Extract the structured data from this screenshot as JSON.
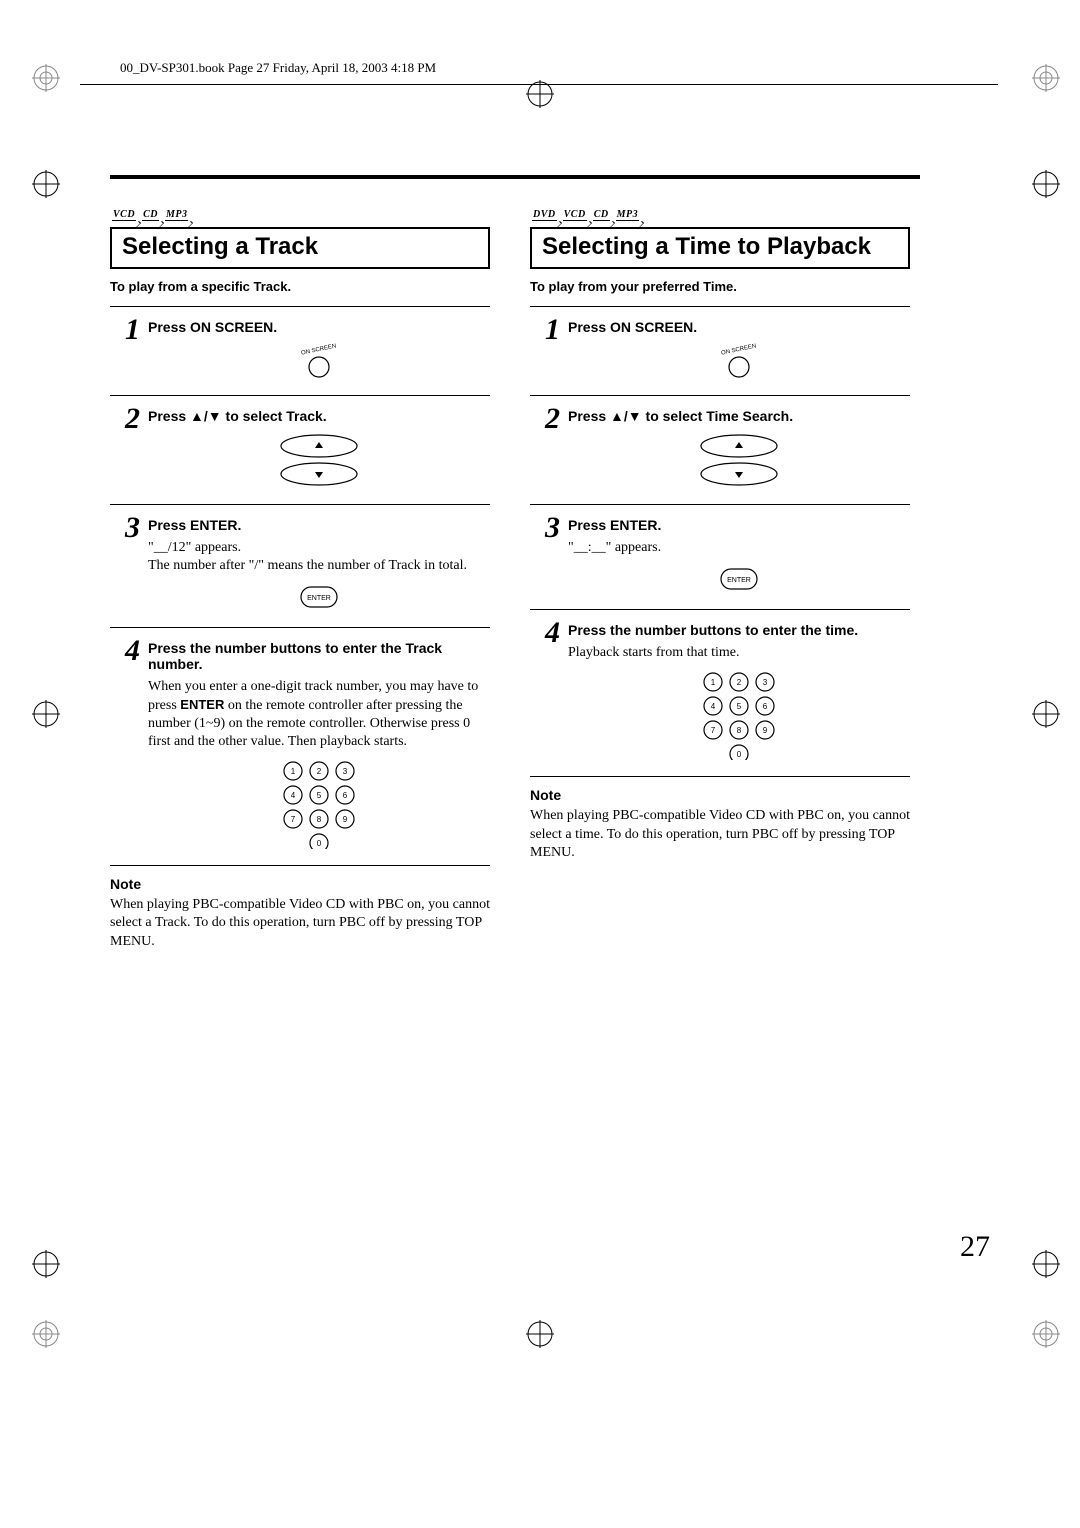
{
  "header": "00_DV-SP301.book  Page 27  Friday, April 18, 2003  4:18 PM",
  "pageNumber": "27",
  "left": {
    "tags": [
      "VCD",
      "CD",
      "MP3"
    ],
    "title": "Selecting a Track",
    "intro": "To play from a specific Track.",
    "step1_h": "Press ON SCREEN.",
    "step2_h": "Press ▲/▼ to select Track.",
    "step3_h": "Press ENTER.",
    "step3_t1": "\"__/12\" appears.",
    "step3_t2": "The number after \"/\" means the number of Track in total.",
    "step4_h": "Press the number buttons to enter the Track number.",
    "step4_t1": "When you enter a one-digit track number, you may have to press ",
    "step4_t1_cmd": "ENTER",
    "step4_t1b": " on the remote controller after pressing the number (1~9) on the remote controller. Otherwise press 0 first and the other value. Then playback starts.",
    "note_label": "Note",
    "note_t1": "When playing PBC-compatible Video CD with PBC on, you cannot select a Track. To do this operation, turn PBC off by pressing ",
    "note_cmd": "TOP MENU",
    "note_t2": "."
  },
  "right": {
    "tags": [
      "DVD",
      "VCD",
      "CD",
      "MP3"
    ],
    "title": "Selecting a Time to Playback",
    "intro": "To play from your preferred Time.",
    "step1_h": "Press ON SCREEN.",
    "step2_h": "Press ▲/▼ to select Time Search.",
    "step3_h": "Press ENTER.",
    "step3_t1": "\"__:__\" appears.",
    "step4_h": "Press the number buttons to enter the time.",
    "step4_t1": "Playback starts from that time.",
    "note_label": "Note",
    "note_t1": "When playing PBC-compatible Video CD with PBC on, you cannot select a time. To do this operation, turn PBC off by pressing ",
    "note_cmd": "TOP MENU",
    "note_t2": "."
  },
  "icons": {
    "onscreen_label": "ON SCREEN",
    "enter_label": "ENTER"
  }
}
